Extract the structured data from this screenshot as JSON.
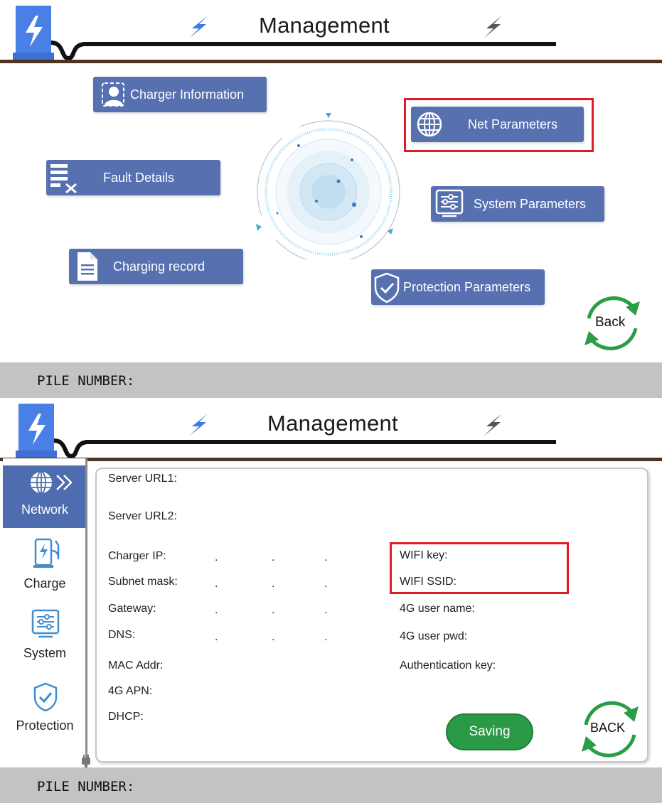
{
  "screen1": {
    "header": {
      "title": "Management"
    },
    "menu": {
      "charger_information": "Charger Information",
      "fault_details": "Fault Details",
      "charging_record": "Charging record",
      "net_parameters": "Net Parameters",
      "system_parameters": "System Parameters",
      "protection_parameters": "Protection Parameters"
    },
    "back_label": "Back",
    "pile_number_label": "PILE NUMBER:"
  },
  "screen2": {
    "header": {
      "title": "Management"
    },
    "sidebar": {
      "items": [
        {
          "label": "Network",
          "active": true
        },
        {
          "label": "Charge"
        },
        {
          "label": "System"
        },
        {
          "label": "Protection"
        }
      ]
    },
    "fields": {
      "server_url1": "Server URL1:",
      "server_url2": "Server URL2:",
      "charger_ip": "Charger IP:",
      "subnet_mask": "Subnet mask:",
      "gateway": "Gateway:",
      "dns": "DNS:",
      "mac_addr": "MAC Addr:",
      "apn_4g": "4G APN:",
      "dhcp": "DHCP:",
      "wifi_key": "WIFI key:",
      "wifi_ssid": "WIFI SSID:",
      "user_name_4g": "4G user name:",
      "user_pwd_4g": "4G user pwd:",
      "authentication_key": "Authentication key:"
    },
    "ip_separator": ".",
    "save_label": "Saving",
    "back_label": "BACK",
    "pile_number_label": "PILE NUMBER:"
  },
  "colors": {
    "menu_button": "#5670b0",
    "highlight": "#e01b24",
    "header_line": "#4e3422",
    "save_green": "#2b9a47",
    "back_green": "#2a9d45",
    "pile_bar": "#c3c3c3"
  }
}
